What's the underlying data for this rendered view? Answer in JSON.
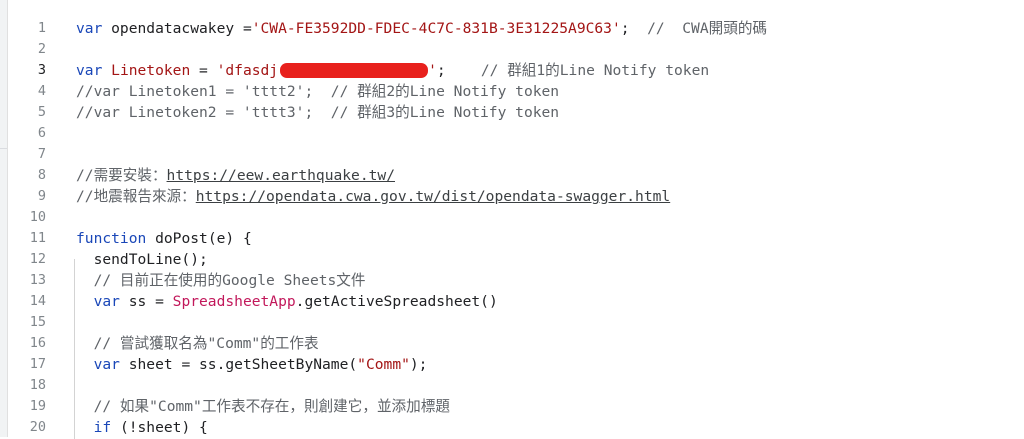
{
  "lines": [
    {
      "n": "1",
      "parts": [
        [
          "kw",
          "var"
        ],
        [
          "t",
          " opendatacwakey ="
        ],
        [
          "str",
          "'CWA-FE3592DD-FDEC-4C7C-831B-3E31225A9C63'"
        ],
        [
          "t",
          ";  "
        ],
        [
          "cmt",
          "//  CWA開頭的碼"
        ]
      ]
    },
    {
      "n": "2",
      "parts": []
    },
    {
      "n": "3",
      "parts": [
        [
          "kw",
          "var"
        ],
        [
          "t",
          " "
        ],
        [
          "str",
          "Linetoken"
        ],
        [
          "t",
          " = "
        ],
        [
          "str",
          "'dfasdj"
        ],
        [
          "redact",
          ""
        ],
        [
          "str",
          "'"
        ],
        [
          "t",
          ";    "
        ],
        [
          "cmt",
          "// 群組1的Line Notify token"
        ]
      ],
      "active": true
    },
    {
      "n": "4",
      "parts": [
        [
          "cmt",
          "//var Linetoken1 = 'tttt2';  // 群組2的Line Notify token"
        ]
      ]
    },
    {
      "n": "5",
      "parts": [
        [
          "cmt",
          "//var Linetoken2 = 'tttt3';  // 群組3的Line Notify token"
        ]
      ]
    },
    {
      "n": "6",
      "parts": []
    },
    {
      "n": "7",
      "parts": []
    },
    {
      "n": "8",
      "parts": [
        [
          "cmt",
          "//需要安裝："
        ],
        [
          "link",
          "https://eew.earthquake.tw/"
        ]
      ]
    },
    {
      "n": "9",
      "parts": [
        [
          "cmt",
          "//地震報告來源："
        ],
        [
          "link",
          "https://opendata.cwa.gov.tw/dist/opendata-swagger.html"
        ]
      ]
    },
    {
      "n": "10",
      "parts": []
    },
    {
      "n": "11",
      "parts": [
        [
          "kw",
          "function"
        ],
        [
          "t",
          " "
        ],
        [
          "fn",
          "doPost"
        ],
        [
          "t",
          "(e) {"
        ]
      ]
    },
    {
      "n": "12",
      "parts": [
        [
          "t",
          "  sendToLine();"
        ]
      ]
    },
    {
      "n": "13",
      "parts": [
        [
          "cmt",
          "  // 目前正在使用的Google Sheets文件"
        ]
      ]
    },
    {
      "n": "14",
      "parts": [
        [
          "t",
          "  "
        ],
        [
          "kw",
          "var"
        ],
        [
          "t",
          " ss = "
        ],
        [
          "cls",
          "SpreadsheetApp"
        ],
        [
          "t",
          ".getActiveSpreadsheet()"
        ]
      ]
    },
    {
      "n": "15",
      "parts": []
    },
    {
      "n": "16",
      "parts": [
        [
          "cmt",
          "  // 嘗試獲取名為\"Comm\"的工作表"
        ]
      ]
    },
    {
      "n": "17",
      "parts": [
        [
          "t",
          "  "
        ],
        [
          "kw",
          "var"
        ],
        [
          "t",
          " sheet = ss.getSheetByName("
        ],
        [
          "str",
          "\"Comm\""
        ],
        [
          "t",
          ");"
        ]
      ]
    },
    {
      "n": "18",
      "parts": []
    },
    {
      "n": "19",
      "parts": [
        [
          "cmt",
          "  // 如果\"Comm\"工作表不存在，則創建它，並添加標題"
        ]
      ]
    },
    {
      "n": "20",
      "parts": [
        [
          "t",
          "  "
        ],
        [
          "kw",
          "if"
        ],
        [
          "t",
          " (!sheet) {"
        ]
      ]
    }
  ]
}
